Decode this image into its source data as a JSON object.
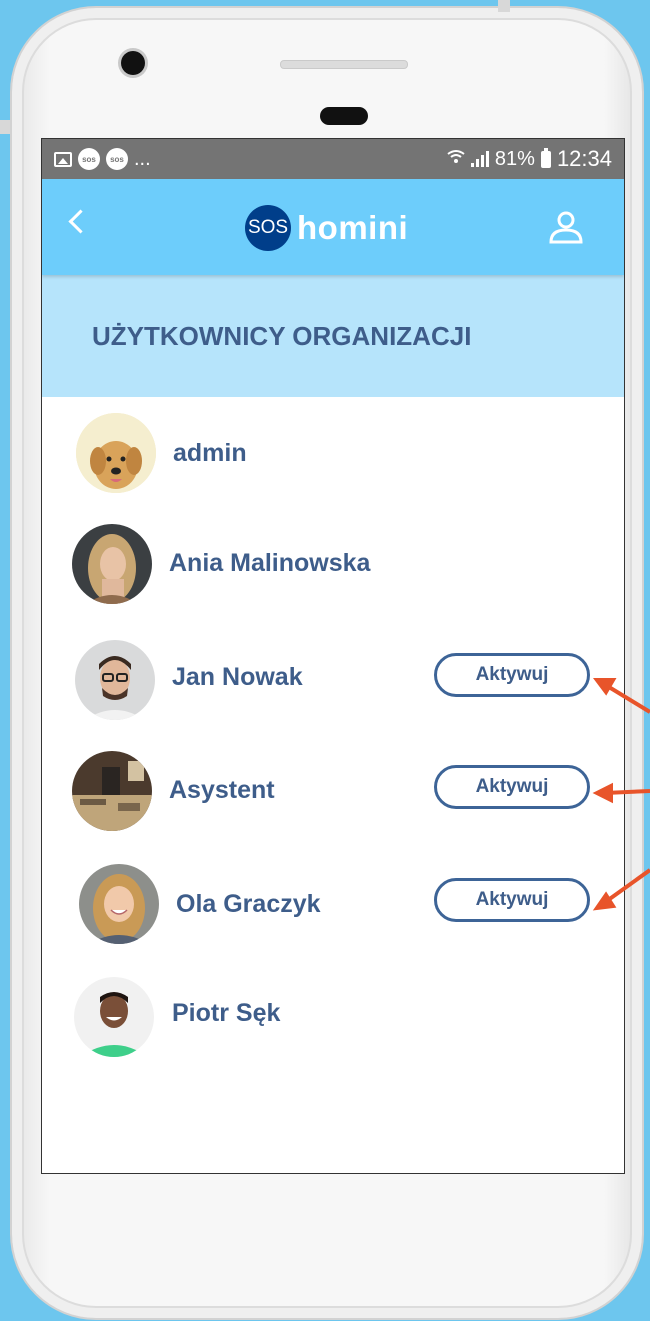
{
  "statusbar": {
    "more": "...",
    "battery_pct": "81%",
    "time": "12:34",
    "sos_badge": "sos"
  },
  "appbar": {
    "logo_badge": "SOS",
    "logo_text": "homini"
  },
  "section": {
    "title": "UŻYTKOWNICY ORGANIZACJI"
  },
  "users": [
    {
      "name": "admin"
    },
    {
      "name": "Ania Malinowska"
    },
    {
      "name": "Jan Nowak",
      "action": "Aktywuj"
    },
    {
      "name": "Asystent",
      "action": "Aktywuj"
    },
    {
      "name": "Ola Graczyk",
      "action": "Aktywuj"
    },
    {
      "name": "Piotr Sęk"
    }
  ],
  "colors": {
    "appbar": "#6dcdfb",
    "section": "#b6e4fb",
    "text": "#3e5d8a",
    "arrow": "#e8542a",
    "page_bg": "#6dc6ee"
  }
}
